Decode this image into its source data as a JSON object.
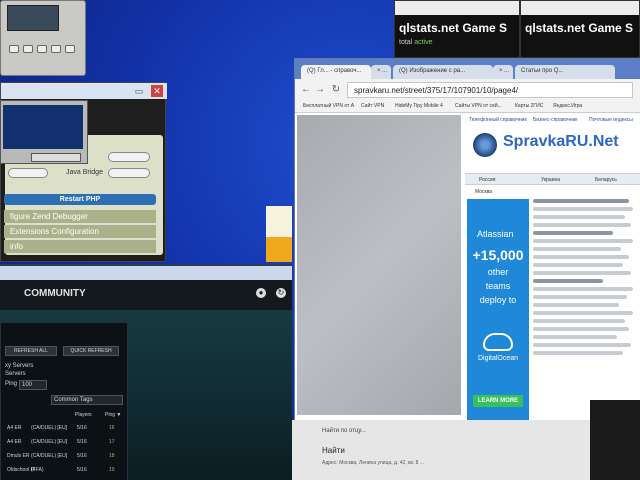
{
  "desktop": {
    "top_right_windows": [
      {
        "title": "qlstats.net Game S",
        "status_prefix": "total",
        "status_active": "active"
      },
      {
        "title": "qlstats.net Game S"
      }
    ]
  },
  "xampp_panel": {
    "option_label": "Java Bridge",
    "restart_label": "Restart PHP",
    "rows": [
      "figure Zend Debugger",
      "Extensions Configuration",
      "info"
    ]
  },
  "steam": {
    "title": "COMMUNITY",
    "buttons": {
      "refresh_all": "REFRESH ALL",
      "quick_refresh": "QUICK REFRESH"
    },
    "labels": {
      "servers_line1": "xy Servers",
      "servers_line2": "Servers",
      "ping_label": "Ping",
      "ping_value": "100",
      "tags_value": "Common Tags"
    },
    "columns": {
      "players": "Players",
      "ping": "Ping ▼"
    },
    "rows": [
      {
        "name": "A4 ER",
        "mode": "(CA/DUEL) [EU]",
        "players": "5/16",
        "ping": "16"
      },
      {
        "name": "A4 ER",
        "mode": "(CA/DUEL) [EU]",
        "players": "5/16",
        "ping": "17"
      },
      {
        "name": "Dmuls ER",
        "mode": "(CA/DUEL) [EU]",
        "players": "5/16",
        "ping": "18"
      },
      {
        "name": "Oldschool Pl",
        "mode": "(FFA)",
        "players": "5/16",
        "ping": "19"
      }
    ]
  },
  "browser": {
    "tabs": [
      "(Q) Гл... - справоч...",
      "× ...",
      "(Q) Изображение с ра...",
      "× ...",
      "Статьи про Q..."
    ],
    "url": "spravkaru.net/street/375/17/107901/10/page4/",
    "bookmarks": [
      "Бесплатный VPN от A",
      "Сайт VPN",
      "HideMy Tipy Mobile 4",
      "Сайты VPN от сей...",
      "Карты 2ГИС",
      "Яндекс.Игра"
    ],
    "site": {
      "nav": [
        "Телефонный справочник",
        "Бизнес-справочник",
        "Почтовые индексы"
      ],
      "logo": "SpravkaRU.Net",
      "menu": [
        "Россия",
        "Украина",
        "Беларусь"
      ],
      "sub": "Москва",
      "ad": {
        "brand": "Atlassian",
        "number": "+15,000",
        "line1": "other",
        "line2": "teams",
        "line3": "deploy to",
        "do_label": "DigitalOcean",
        "cta": "LEARN MORE"
      }
    }
  },
  "bottom_page": {
    "t1": "Найти по отцу...",
    "t2": "Найти",
    "t3": "Адрес: Москва, Ленина улица, д. 42, кв. 8 ..."
  }
}
